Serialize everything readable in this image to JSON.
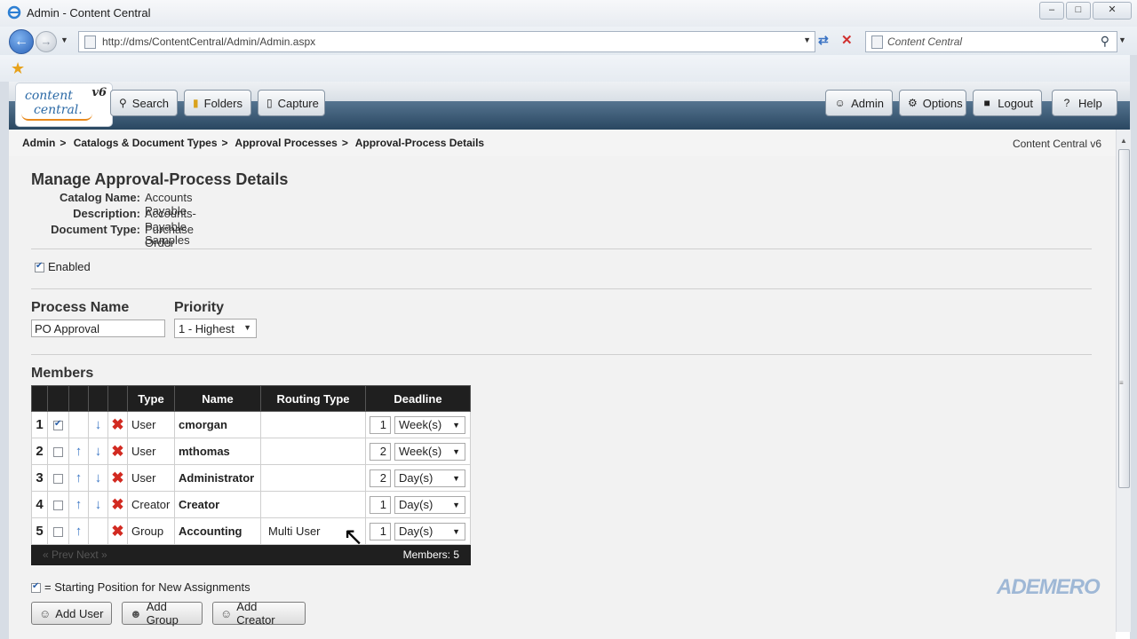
{
  "window": {
    "title": "Admin - Content Central"
  },
  "browser": {
    "url": "http://dms/ContentCentral/Admin/Admin.aspx",
    "search_placeholder": "Content Central"
  },
  "app": {
    "logo_line1": "content",
    "logo_line2": "central.",
    "logo_version": "v6",
    "nav_left": [
      "Search",
      "Folders",
      "Capture"
    ],
    "nav_right": [
      "Admin",
      "Options",
      "Logout",
      "Help"
    ]
  },
  "breadcrumb": [
    "Admin",
    "Catalogs & Document Types",
    "Approval Processes",
    "Approval-Process Details"
  ],
  "version_label": "Content Central v6",
  "page": {
    "title": "Manage Approval-Process Details",
    "catalog_label": "Catalog Name:",
    "catalog_value": "Accounts Payable",
    "description_label": "Description:",
    "description_value": "Accounts-Payable Samples",
    "doctype_label": "Document Type:",
    "doctype_value": "Purchase Order",
    "enabled_label": "Enabled",
    "process_name_label": "Process Name",
    "process_name_value": "PO Approval",
    "priority_label": "Priority",
    "priority_value": "1 - Highest",
    "members_label": "Members"
  },
  "members": {
    "headers": [
      "Type",
      "Name",
      "Routing Type",
      "Deadline"
    ],
    "rows": [
      {
        "num": "1",
        "checked": true,
        "up": false,
        "down": true,
        "type": "User",
        "name": "cmorgan",
        "routing": "",
        "deadline": "1",
        "unit": "Week(s)"
      },
      {
        "num": "2",
        "checked": false,
        "up": true,
        "down": true,
        "type": "User",
        "name": "mthomas",
        "routing": "",
        "deadline": "2",
        "unit": "Week(s)"
      },
      {
        "num": "3",
        "checked": false,
        "up": true,
        "down": true,
        "type": "User",
        "name": "Administrator",
        "routing": "",
        "deadline": "2",
        "unit": "Day(s)"
      },
      {
        "num": "4",
        "checked": false,
        "up": true,
        "down": true,
        "type": "Creator",
        "name": "Creator",
        "routing": "",
        "deadline": "1",
        "unit": "Day(s)"
      },
      {
        "num": "5",
        "checked": false,
        "up": true,
        "down": false,
        "type": "Group",
        "name": "Accounting",
        "routing": "Multi User",
        "deadline": "1",
        "unit": "Day(s)"
      }
    ],
    "pager": "« Prev Next »",
    "count": "Members: 5"
  },
  "legend_text": "= Starting Position for New Assignments",
  "actions": [
    "Add User",
    "Add Group",
    "Add Creator"
  ],
  "watermark": "ADEMERO"
}
